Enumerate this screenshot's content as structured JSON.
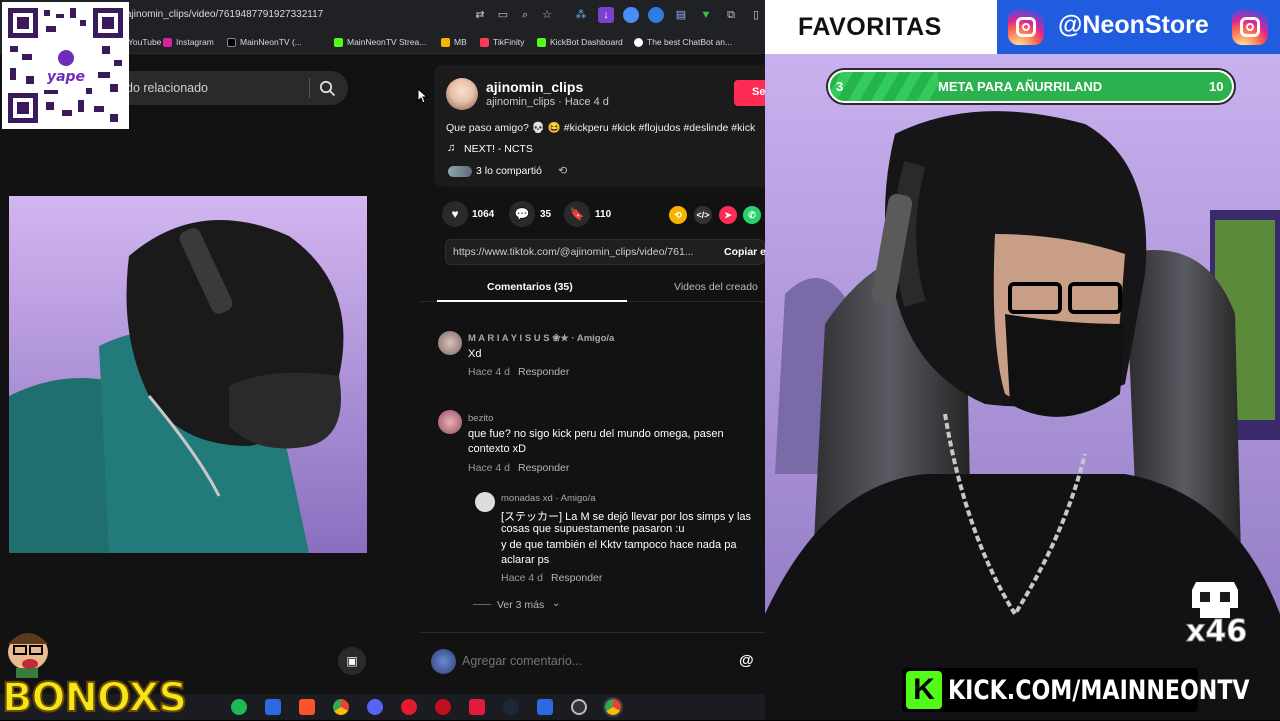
{
  "browser": {
    "url": "ajinomin_clips/video/7619487791927332117",
    "bookmarks": [
      "YouTube",
      "Instagram",
      "MainNeonTV (...",
      "MainNeonTV Strea...",
      "MB",
      "TikFinity",
      "KickBot Dashboard",
      "The best ChatBot an..."
    ]
  },
  "left_video": {
    "search_text": "do relacionado"
  },
  "post": {
    "username": "ajinomin_clips",
    "subline": "ajinomin_clips · Hace 4 d",
    "follow_label": "Se",
    "caption": "Que paso amigo? 💀 😆 #kickperu #kick #flojudos #deslinde #kick",
    "music": "NEXT! - NCTS",
    "shared": "3 lo compartió",
    "likes": "1064",
    "comments": "35",
    "saves": "110",
    "link": "https://www.tiktok.com/@ajinomin_clips/video/761...",
    "copy_label": "Copiar e",
    "tab_comments": "Comentarios (35)",
    "tab_videos": "Videos del creado"
  },
  "comments": [
    {
      "user": "M A R I A Y I S U S ❀★ · Amigo/a",
      "text": "Xd",
      "time": "Hace 4 d",
      "reply": "Responder"
    },
    {
      "user": "bezito",
      "text1": "que fue? no sigo kick peru del mundo omega, pasen",
      "text2": "contexto xD",
      "time": "Hace 4 d",
      "reply": "Responder"
    },
    {
      "user": "monadas xd · Amigo/a",
      "text1": "[ステッカー] La M se dejó llevar por los simps y las",
      "text2": "cosas que supuestamente pasaron :u",
      "text3": "y de que también el Kktv tampoco hace nada pa",
      "text4": "aclarar ps",
      "time": "Hace 4 d",
      "reply": "Responder"
    }
  ],
  "more_replies": "Ver 3 más",
  "comment_input_placeholder": "Agregar comentario...",
  "overlay": {
    "favoritas": "FAVORITAS",
    "ig_handle": "@NeonStore",
    "goal_current": "3",
    "goal_label": "META PARA AÑURRILAND",
    "goal_target": "10",
    "goal_progress": 0.3,
    "kick_url": "KICK.COM/MAINNEONTV",
    "counter": "x46",
    "bonoxs": "BONOXS"
  },
  "colors": {
    "tiktok_red": "#fe2c55",
    "kick_green": "#53fc18",
    "ig_blue": "#1f5ce0"
  }
}
